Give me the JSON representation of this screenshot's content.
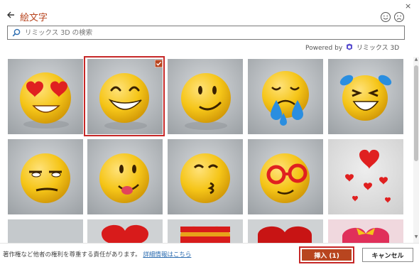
{
  "dialog": {
    "title": "絵文字",
    "close_glyph": "×"
  },
  "header": {
    "feedback_positive_icon": "smile-icon",
    "feedback_negative_icon": "frown-icon"
  },
  "search": {
    "placeholder": "リミックス 3D の検索",
    "value": ""
  },
  "attribution": {
    "prefix": "Powered by",
    "brand": "リミックス 3D"
  },
  "grid": {
    "tiles": [
      {
        "label": "heart-eyes-face",
        "selected": false
      },
      {
        "label": "grinning-face",
        "selected": true
      },
      {
        "label": "slightly-smiling-face",
        "selected": false
      },
      {
        "label": "sad-tears-face",
        "selected": false
      },
      {
        "label": "tears-of-joy-face",
        "selected": false
      },
      {
        "label": "unamused-face",
        "selected": false
      },
      {
        "label": "tongue-out-face",
        "selected": false
      },
      {
        "label": "kissing-face",
        "selected": false
      },
      {
        "label": "glasses-face",
        "selected": false
      },
      {
        "label": "hearts",
        "selected": false
      },
      {
        "label": "blank",
        "selected": false
      },
      {
        "label": "red-heart",
        "selected": false
      },
      {
        "label": "flag-heart",
        "selected": false
      },
      {
        "label": "red-heart-2",
        "selected": false
      },
      {
        "label": "heart-with-ribbon",
        "selected": false
      }
    ]
  },
  "footer": {
    "notice": "著作権など他者の権利を尊重する責任があります。",
    "details_link": "詳細情報はこちら",
    "insert_label": "挿入 (1)",
    "cancel_label": "キャンセル"
  },
  "colors": {
    "accent": "#b8451f",
    "selection_outline": "#c62828",
    "emoji_yellow": "#f5c518",
    "heart_red": "#e02020",
    "tear_blue": "#2a8ee0"
  }
}
